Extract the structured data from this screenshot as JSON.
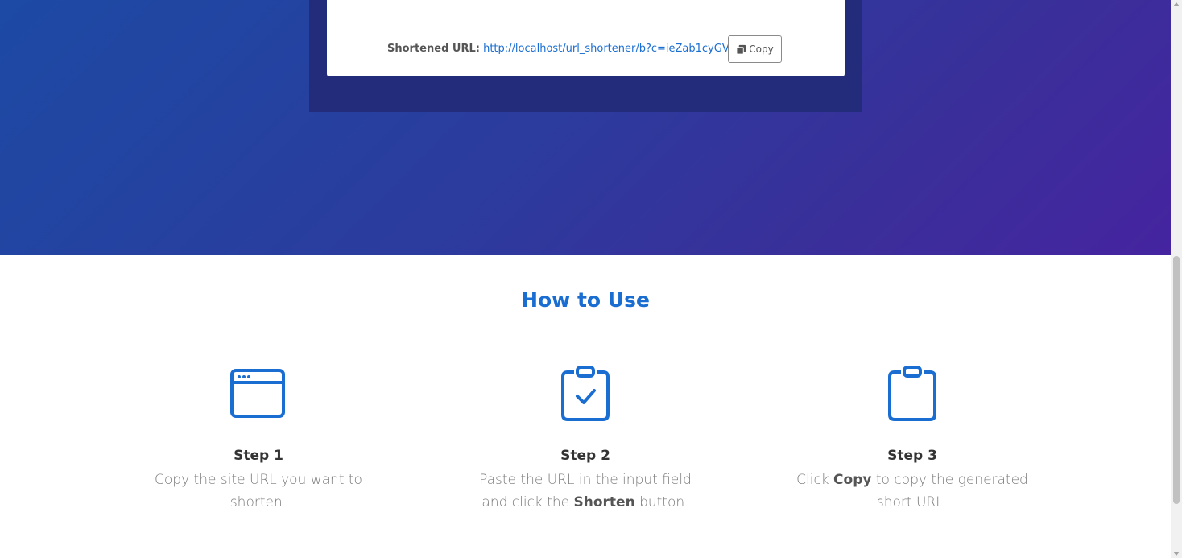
{
  "result": {
    "label": "Shortened URL:",
    "url": "http://localhost/url_shortener/b?c=ieZab1cyGV",
    "copy_label": "Copy"
  },
  "how_to": {
    "title": "How to Use",
    "steps": [
      {
        "title": "Step 1",
        "text": "Copy the site URL you want to shorten.",
        "icon": "browser-window-icon"
      },
      {
        "title": "Step 2",
        "text_before": "Paste the URL in the input field and click the ",
        "bold": "Shorten",
        "text_after": " button.",
        "icon": "clipboard-check-icon"
      },
      {
        "title": "Step 3",
        "text_before": "Click ",
        "bold": "Copy",
        "text_after": " to copy the generated short URL.",
        "icon": "clipboard-icon"
      }
    ]
  },
  "colors": {
    "accent": "#1a6ed1",
    "hero_start": "#1c4aa4",
    "hero_end": "#4524a0"
  }
}
